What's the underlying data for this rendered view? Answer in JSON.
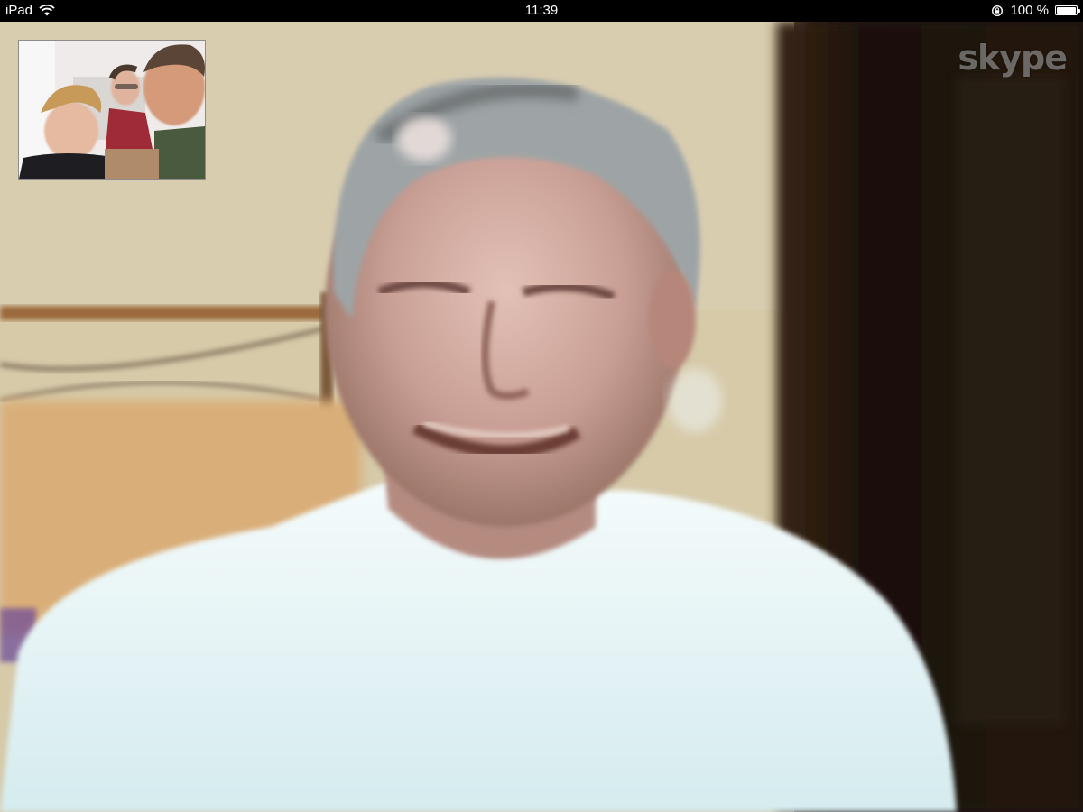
{
  "status_bar": {
    "device": "iPad",
    "time": "11:39",
    "battery_percent_label": "100 %",
    "battery_level": 1.0,
    "wifi": "wifi-icon",
    "orientation_lock": "lock-rotation-icon"
  },
  "call": {
    "brand_logo": "skype",
    "remote_video": "remote-participant-video",
    "self_preview": "self-camera-preview"
  },
  "colors": {
    "status_bar_bg": "#000000",
    "status_bar_text": "#ffffff",
    "logo_color": "#ffffff"
  }
}
